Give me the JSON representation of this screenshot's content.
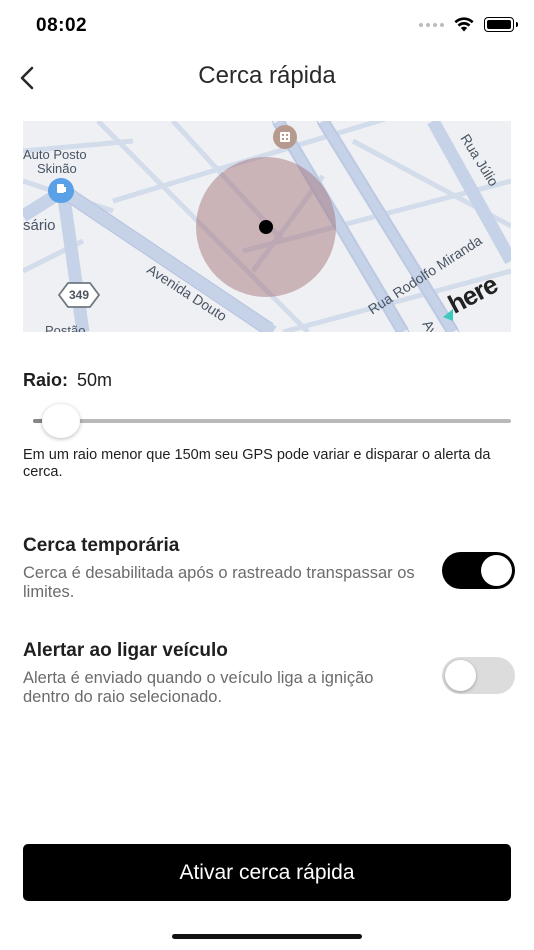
{
  "status_bar": {
    "time": "08:02",
    "icons": [
      "signal-dots-icon",
      "wifi-icon",
      "battery-icon"
    ]
  },
  "nav": {
    "back_icon": "chevron-left-icon",
    "title": "Cerca rápida"
  },
  "map": {
    "labels": {
      "poi_line1": "Auto Posto",
      "poi_line2": "Skinão",
      "street_left": "sário",
      "avenue": "Avenida Douto",
      "route_shield": "349",
      "street_bottom_left": "Postão",
      "street_right": "Rua Rodolfo Miranda",
      "street_top_right": "Rua Júlio",
      "street_bottom_right": "Av",
      "brand": "here"
    },
    "icons": [
      "fuel-station-icon",
      "building-icon",
      "route-shield-icon",
      "here-logo"
    ],
    "colors": {
      "background": "#eef0f3",
      "roads": "#ccd7ea",
      "fence_circle": "#a06a72",
      "poi_pin": "#5aa0e6"
    }
  },
  "radius": {
    "label": "Raio:",
    "value": "50m",
    "slider_fraction": 0.04,
    "hint": "Em um raio menor que 150m seu GPS pode variar e disparar o alerta da cerca."
  },
  "settings": [
    {
      "title": "Cerca temporária",
      "description": "Cerca é desabilitada após o rastreado transpassar os limites.",
      "enabled": true
    },
    {
      "title": "Alertar ao ligar veículo",
      "description": "Alerta é enviado quando o veículo liga a ignição dentro do raio selecionado.",
      "enabled": false
    }
  ],
  "primary_button": {
    "label": "Ativar cerca rápida"
  },
  "colors": {
    "primary": "#000000",
    "toggle_off": "#dcdcdc",
    "secondary_text": "#6b6b6b"
  }
}
